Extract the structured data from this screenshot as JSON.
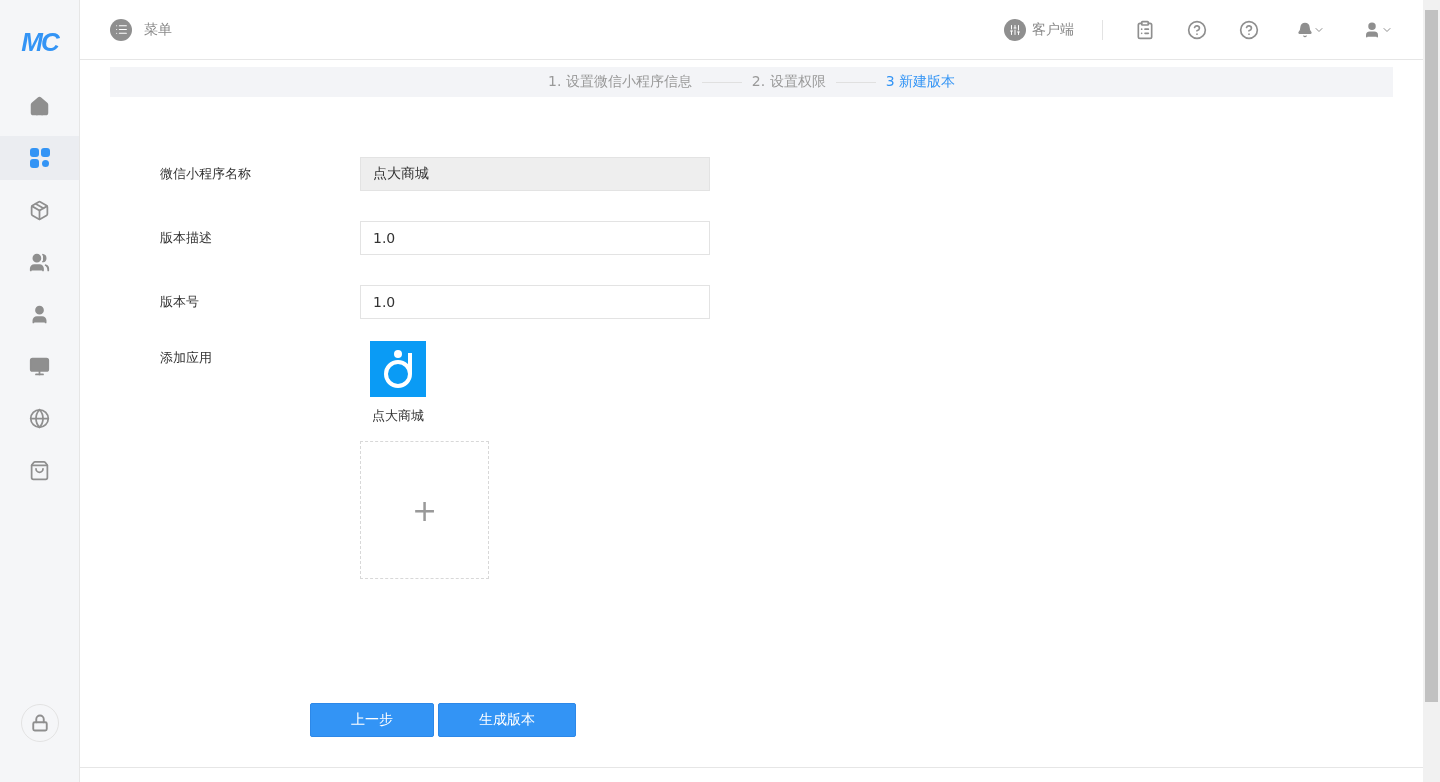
{
  "logo": "MC",
  "sidebar": {
    "items": [
      {
        "kind": "home",
        "selected": false
      },
      {
        "kind": "apps",
        "selected": true
      },
      {
        "kind": "package",
        "selected": false
      },
      {
        "kind": "users",
        "selected": false
      },
      {
        "kind": "user-lock",
        "selected": false
      },
      {
        "kind": "monitor",
        "selected": false
      },
      {
        "kind": "globe",
        "selected": false
      },
      {
        "kind": "bag",
        "selected": false
      }
    ]
  },
  "header": {
    "menu_label": "菜单",
    "client_label": "客户端"
  },
  "steps": [
    {
      "label": "1. 设置微信小程序信息",
      "selected": false
    },
    {
      "label": "2. 设置权限",
      "selected": false
    },
    {
      "label": "3 新建版本",
      "selected": true
    }
  ],
  "form": {
    "fields": [
      {
        "label": "微信小程序名称",
        "value": "点大商城",
        "disabled": true
      },
      {
        "label": "版本描述",
        "value": "1.0",
        "disabled": false
      },
      {
        "label": "版本号",
        "value": "1.0",
        "disabled": false
      }
    ],
    "apps_label": "添加应用",
    "apps": [
      {
        "name": "点大商城"
      }
    ],
    "add_symbol": "+"
  },
  "buttons": [
    {
      "label": "上一步"
    },
    {
      "label": "生成版本"
    }
  ]
}
